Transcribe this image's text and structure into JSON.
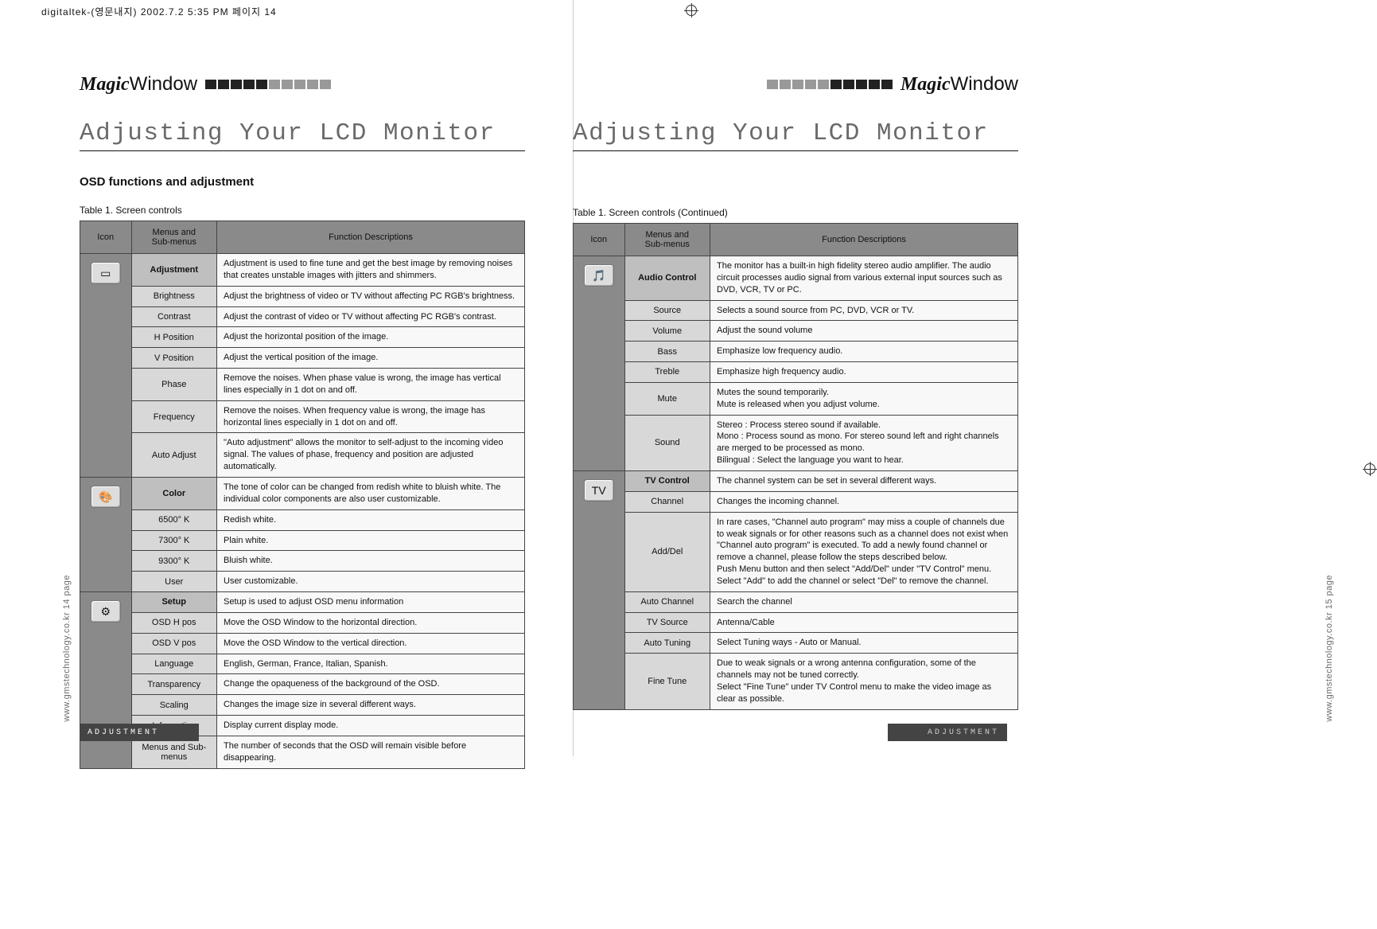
{
  "meta": {
    "top_marker": "digitaltek-(영문내지)  2002.7.2 5:35 PM  페이지 14",
    "side_left": "www.gmstechnology.co.kr  14 page",
    "side_right": "www.gmstechnology.co.kr  15 page"
  },
  "brand": {
    "bold": "Magic",
    "thin": "Window"
  },
  "heading": "Adjusting Your LCD Monitor",
  "left": {
    "sub": "OSD functions and adjustment",
    "caption": "Table 1. Screen controls",
    "th": {
      "c1": "Icon",
      "c2": "Menus and\nSub-menus",
      "c3": "Function Descriptions"
    },
    "groups": [
      {
        "icon": "▭",
        "rows": [
          {
            "menu": "Adjustment",
            "head": true,
            "desc": "Adjustment is used to fine tune and get the best image by removing noises that creates unstable images with jitters and shimmers."
          },
          {
            "menu": "Brightness",
            "desc": "Adjust the brightness of video or TV without affecting PC RGB's brightness."
          },
          {
            "menu": "Contrast",
            "desc": "Adjust the contrast of video or TV without affecting PC RGB's contrast."
          },
          {
            "menu": "H Position",
            "desc": "Adjust the horizontal position of the image."
          },
          {
            "menu": "V Position",
            "desc": "Adjust the vertical position of the image."
          },
          {
            "menu": "Phase",
            "desc": "Remove the noises. When phase value is wrong, the image has vertical lines especially in 1 dot on and off."
          },
          {
            "menu": "Frequency",
            "desc": "Remove the noises. When frequency value is wrong, the image has horizontal lines especially in 1 dot on and off."
          },
          {
            "menu": "Auto Adjust",
            "desc": "\"Auto adjustment\" allows the monitor to self-adjust to the incoming video signal. The values of phase, frequency and position are adjusted automatically."
          }
        ]
      },
      {
        "icon": "🎨",
        "rows": [
          {
            "menu": "Color",
            "head": true,
            "desc": "The tone of color can be changed from redish white to bluish white. The individual color components are also user customizable."
          },
          {
            "menu": "6500° K",
            "desc": "Redish white."
          },
          {
            "menu": "7300° K",
            "desc": "Plain white."
          },
          {
            "menu": "9300° K",
            "desc": "Bluish white."
          },
          {
            "menu": "User",
            "desc": "User customizable."
          }
        ]
      },
      {
        "icon": "⚙",
        "rows": [
          {
            "menu": "Setup",
            "head": true,
            "desc": "Setup is used to adjust OSD menu information"
          },
          {
            "menu": "OSD H pos",
            "desc": "Move the OSD Window to the horizontal direction."
          },
          {
            "menu": "OSD V pos",
            "desc": "Move the OSD Window to the vertical direction."
          },
          {
            "menu": "Language",
            "desc": "English, German, France, Italian, Spanish."
          },
          {
            "menu": "Transparency",
            "desc": "Change the opaqueness of the background of the OSD."
          },
          {
            "menu": "Scaling",
            "desc": "Changes the image size in several different ways."
          },
          {
            "menu": "Information",
            "desc": "Display current display mode."
          },
          {
            "menu": "Menus and Sub-menus",
            "desc": "The number of seconds that the OSD will remain visible before disappearing."
          }
        ]
      }
    ]
  },
  "right": {
    "caption": "Table 1. Screen controls (Continued)",
    "th": {
      "c1": "Icon",
      "c2": "Menus and\nSub-menus",
      "c3": "Function Descriptions"
    },
    "groups": [
      {
        "icon": "🎵",
        "rows": [
          {
            "menu": "Audio Control",
            "head": true,
            "desc": "The monitor has a built-in high fidelity stereo audio amplifier. The audio circuit processes audio signal from various external input sources such as DVD, VCR, TV or PC."
          },
          {
            "menu": "Source",
            "desc": "Selects a sound source from PC, DVD, VCR or TV."
          },
          {
            "menu": "Volume",
            "desc": "Adjust the sound volume"
          },
          {
            "menu": "Bass",
            "desc": "Emphasize low frequency audio."
          },
          {
            "menu": "Treble",
            "desc": "Emphasize high frequency audio."
          },
          {
            "menu": "Mute",
            "desc": "Mutes the sound temporarily.\nMute is released when you adjust volume."
          },
          {
            "menu": "Sound",
            "desc": "Stereo : Process stereo sound if available.\nMono   : Process sound as mono. For stereo sound left and right channels are merged to be processed as mono.\nBilingual : Select the language you want to hear."
          }
        ]
      },
      {
        "icon": "TV",
        "rows": [
          {
            "menu": "TV Control",
            "head": true,
            "desc": "The channel system can be set in several different ways."
          },
          {
            "menu": "Channel",
            "desc": "Changes the incoming channel."
          },
          {
            "menu": "Add/Del",
            "desc": "In rare cases, \"Channel auto program\" may miss a couple of channels due to weak signals or for other reasons such as a channel does not exist when \"Channel auto program\" is executed. To add a newly found channel or remove a channel, please follow the steps described below.\nPush Menu button and then select \"Add/Del\" under \"TV Control\" menu. Select \"Add\" to add the channel or select \"Del\" to remove the channel."
          },
          {
            "menu": "Auto Channel",
            "desc": "Search the channel"
          },
          {
            "menu": "TV Source",
            "desc": "Antenna/Cable"
          },
          {
            "menu": "Auto Tuning",
            "desc": "Select Tuning ways - Auto or Manual."
          },
          {
            "menu": "Fine Tune",
            "desc": "Due to weak signals or a wrong antenna configuration, some of the channels may not be tuned correctly.\nSelect \"Fine Tune\" under TV Control menu to make the video image as clear as possible."
          }
        ]
      }
    ]
  },
  "footer_label": "ADJUSTMENT"
}
